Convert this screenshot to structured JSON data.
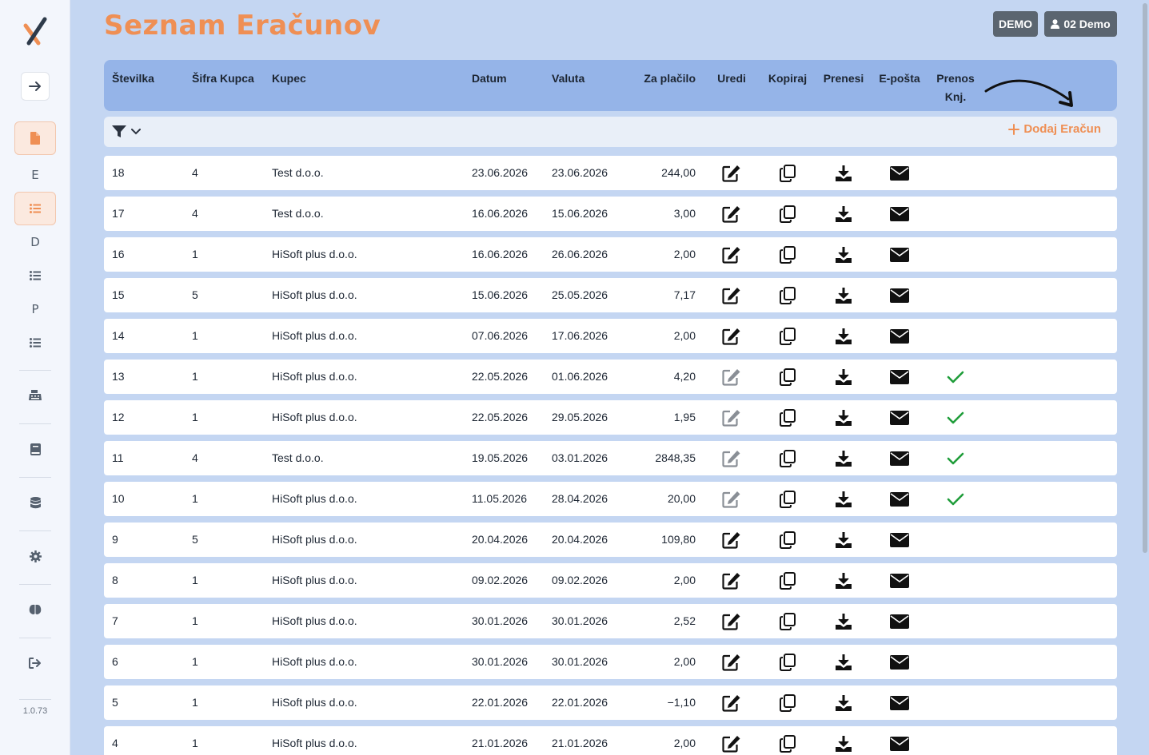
{
  "app": {
    "title": "Seznam Eračunov",
    "version": "1.0.73",
    "demo_badge": "DEMO",
    "user_label": "02 Demo",
    "accent_color": "#ef8f54"
  },
  "sidebar": {
    "items": [
      {
        "kind": "button",
        "icon": "arrow-right-icon"
      },
      {
        "kind": "active",
        "icon": "file-icon"
      },
      {
        "kind": "letter",
        "label": "E"
      },
      {
        "kind": "active",
        "icon": "list-icon"
      },
      {
        "kind": "letter",
        "label": "D"
      },
      {
        "kind": "icon",
        "icon": "list-icon"
      },
      {
        "kind": "letter",
        "label": "P"
      },
      {
        "kind": "icon",
        "icon": "list-icon"
      },
      {
        "kind": "icon",
        "icon": "cash-register-icon"
      },
      {
        "kind": "icon",
        "icon": "book-icon"
      },
      {
        "kind": "icon",
        "icon": "database-icon"
      },
      {
        "kind": "icon",
        "icon": "gear-icon"
      },
      {
        "kind": "icon",
        "icon": "brain-icon"
      },
      {
        "kind": "icon",
        "icon": "logout-icon"
      }
    ]
  },
  "table": {
    "columns": [
      "Številka",
      "Šifra Kupca",
      "Kupec",
      "Datum",
      "Valuta",
      "Za plačilo",
      "Uredi",
      "Kopiraj",
      "Prenesi",
      "E-pošta",
      "Prenos",
      "Knj."
    ],
    "add_label": "Dodaj Eračun",
    "rows": [
      {
        "num": "18",
        "code": "4",
        "customer": "Test d.o.o.",
        "date": "23.06.2026",
        "due": "23.06.2026",
        "amount": "244,00",
        "editable": true,
        "posted": false
      },
      {
        "num": "17",
        "code": "4",
        "customer": "Test d.o.o.",
        "date": "16.06.2026",
        "due": "15.06.2026",
        "amount": "3,00",
        "editable": true,
        "posted": false
      },
      {
        "num": "16",
        "code": "1",
        "customer": "HiSoft plus d.o.o.",
        "date": "16.06.2026",
        "due": "26.06.2026",
        "amount": "2,00",
        "editable": true,
        "posted": false
      },
      {
        "num": "15",
        "code": "5",
        "customer": "HiSoft plus d.o.o.",
        "date": "15.06.2026",
        "due": "25.05.2026",
        "amount": "7,17",
        "editable": true,
        "posted": false
      },
      {
        "num": "14",
        "code": "1",
        "customer": "HiSoft plus d.o.o.",
        "date": "07.06.2026",
        "due": "17.06.2026",
        "amount": "2,00",
        "editable": true,
        "posted": false
      },
      {
        "num": "13",
        "code": "1",
        "customer": "HiSoft plus d.o.o.",
        "date": "22.05.2026",
        "due": "01.06.2026",
        "amount": "4,20",
        "editable": false,
        "posted": true
      },
      {
        "num": "12",
        "code": "1",
        "customer": "HiSoft plus d.o.o.",
        "date": "22.05.2026",
        "due": "29.05.2026",
        "amount": "1,95",
        "editable": false,
        "posted": true
      },
      {
        "num": "11",
        "code": "4",
        "customer": "Test d.o.o.",
        "date": "19.05.2026",
        "due": "03.01.2026",
        "amount": "2848,35",
        "editable": false,
        "posted": true
      },
      {
        "num": "10",
        "code": "1",
        "customer": "HiSoft plus d.o.o.",
        "date": "11.05.2026",
        "due": "28.04.2026",
        "amount": "20,00",
        "editable": false,
        "posted": true
      },
      {
        "num": "9",
        "code": "5",
        "customer": "HiSoft plus d.o.o.",
        "date": "20.04.2026",
        "due": "20.04.2026",
        "amount": "109,80",
        "editable": true,
        "posted": false
      },
      {
        "num": "8",
        "code": "1",
        "customer": "HiSoft plus d.o.o.",
        "date": "09.02.2026",
        "due": "09.02.2026",
        "amount": "2,00",
        "editable": true,
        "posted": false
      },
      {
        "num": "7",
        "code": "1",
        "customer": "HiSoft plus d.o.o.",
        "date": "30.01.2026",
        "due": "30.01.2026",
        "amount": "2,52",
        "editable": true,
        "posted": false
      },
      {
        "num": "6",
        "code": "1",
        "customer": "HiSoft plus d.o.o.",
        "date": "30.01.2026",
        "due": "30.01.2026",
        "amount": "2,00",
        "editable": true,
        "posted": false
      },
      {
        "num": "5",
        "code": "1",
        "customer": "HiSoft plus d.o.o.",
        "date": "22.01.2026",
        "due": "22.01.2026",
        "amount": "−1,10",
        "editable": true,
        "posted": false
      },
      {
        "num": "4",
        "code": "1",
        "customer": "HiSoft plus d.o.o.",
        "date": "21.01.2026",
        "due": "21.01.2026",
        "amount": "2,00",
        "editable": true,
        "posted": false
      }
    ]
  }
}
